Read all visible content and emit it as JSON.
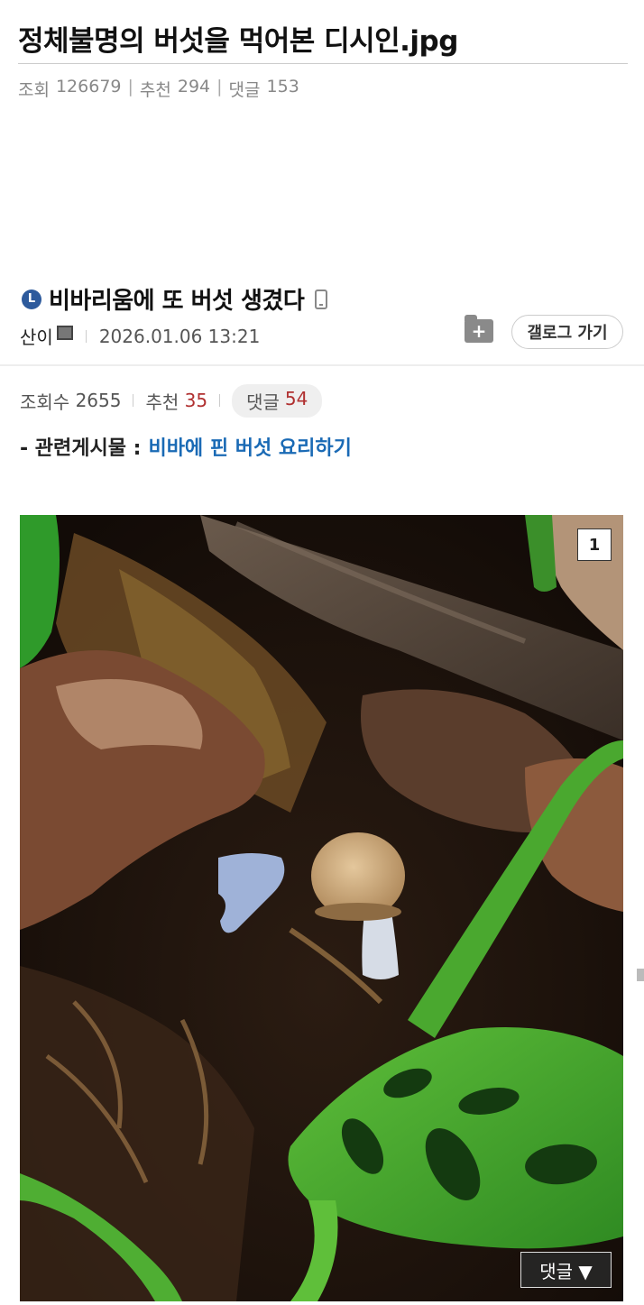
{
  "outer": {
    "title": "정체불명의 버섯을 먹어본 디시인.jpg",
    "views_label": "조회",
    "views": "126679",
    "recommend_label": "추천",
    "recommend": "294",
    "comments_label": "댓글",
    "comments": "153"
  },
  "post": {
    "gallery_badge": "L",
    "title": "비바리움에 또 버섯 생겼다",
    "author": "산이",
    "date": "2026.01.06 13:21",
    "folder_add": "+",
    "gallery_button": "갤로그 가기",
    "views_label": "조회수",
    "views": "2655",
    "recommend_label": "추천",
    "recommend": "35",
    "comments_label": "댓글",
    "comments": "54",
    "related_label": "- 관련게시물 :",
    "related_link": "비바에 핀 버섯 요리하기"
  },
  "image": {
    "index": "1",
    "comment_button": "댓글 ▼"
  },
  "colors": {
    "link": "#1a6ab5",
    "accent_red": "#b03030",
    "badge_blue": "#2d5a9c"
  }
}
